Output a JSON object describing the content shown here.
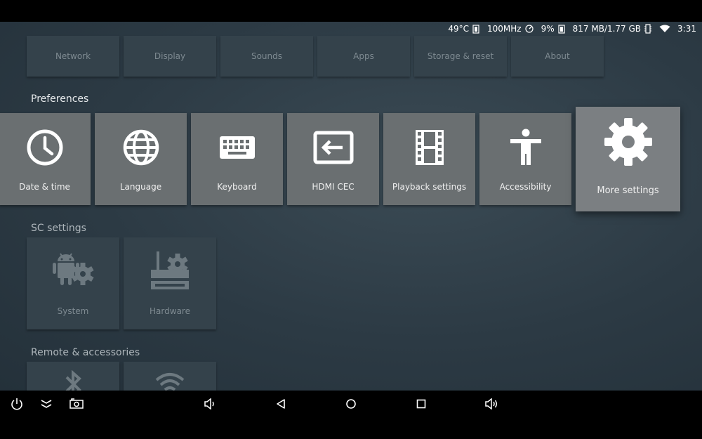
{
  "status": {
    "temperature": "49°C",
    "frequency": "100MHz",
    "cpu": "9%",
    "memory": "817 MB/1.77 GB",
    "time": "3:31"
  },
  "top_row": {
    "items": [
      "Network",
      "Display",
      "Sounds",
      "Apps",
      "Storage & reset",
      "About"
    ]
  },
  "preferences": {
    "title": "Preferences",
    "items": [
      {
        "label": "Date & time",
        "icon": "clock-icon"
      },
      {
        "label": "Language",
        "icon": "globe-icon"
      },
      {
        "label": "Keyboard",
        "icon": "keyboard-icon"
      },
      {
        "label": "HDMI CEC",
        "icon": "input-icon"
      },
      {
        "label": "Playback settings",
        "icon": "film-icon"
      },
      {
        "label": "Accessibility",
        "icon": "accessibility-icon"
      },
      {
        "label": "More settings",
        "icon": "gear-icon"
      }
    ]
  },
  "sc_settings": {
    "title": "SC settings",
    "items": [
      {
        "label": "System",
        "icon": "android-gear-icon"
      },
      {
        "label": "Hardware",
        "icon": "router-gear-icon"
      }
    ]
  },
  "remote": {
    "title": "Remote & accessories",
    "items": [
      {
        "icon": "bluetooth-icon"
      },
      {
        "icon": "wifi-icon"
      }
    ]
  },
  "navbar": {
    "icons": [
      "power-icon",
      "collapse-icon",
      "screenshot-icon",
      "volume-down-icon",
      "back-icon",
      "home-icon",
      "recents-icon",
      "volume-up-icon"
    ]
  }
}
